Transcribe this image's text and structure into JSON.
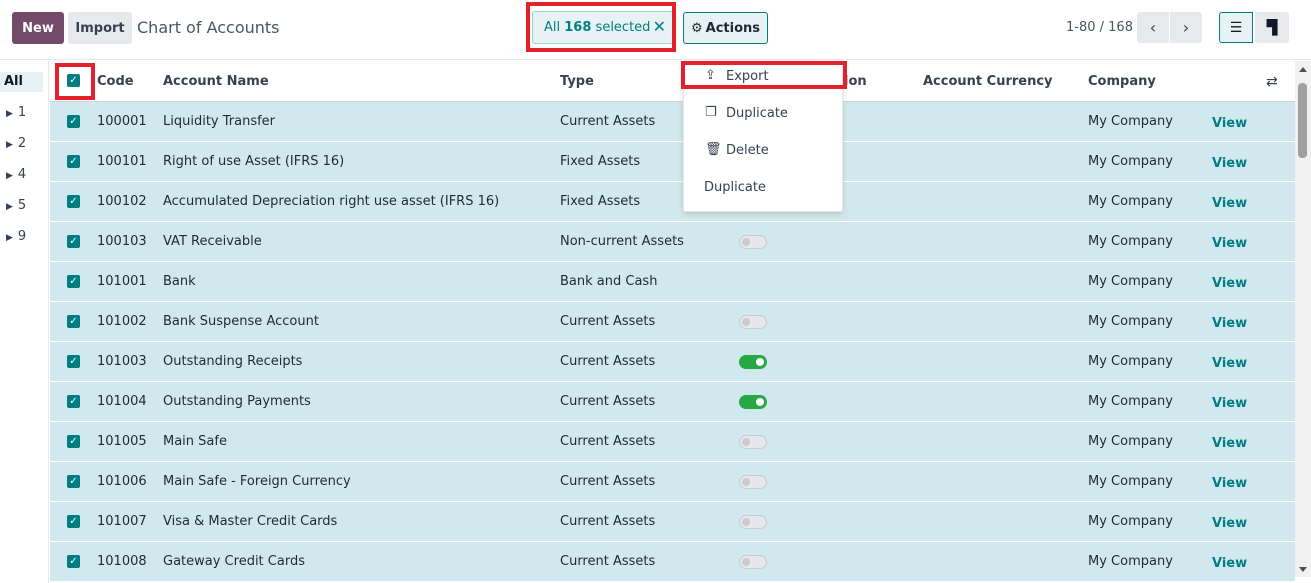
{
  "toolbar": {
    "new_label": "New",
    "import_label": "Import",
    "title": "Chart of Accounts",
    "selection_prefix": "All",
    "selection_count": "168",
    "selection_suffix": "selected",
    "clear_symbol": "✕",
    "actions_label": "Actions",
    "pager_text": "1-80 / 168",
    "prev_symbol": "‹",
    "next_symbol": "›"
  },
  "side_panel": {
    "all_label": "All",
    "groups": [
      "1",
      "2",
      "4",
      "5",
      "9"
    ]
  },
  "columns": {
    "code": "Code",
    "name": "Account Name",
    "type": "Type",
    "reconcile": "ion",
    "currency": "Account Currency",
    "company": "Company"
  },
  "actions_menu": {
    "export": "Export",
    "duplicate_icon_item": "Duplicate",
    "delete": "Delete",
    "duplicate": "Duplicate"
  },
  "rows": [
    {
      "code": "100001",
      "name": "Liquidity Transfer",
      "type": "Current Assets",
      "toggle": "none",
      "company": "My Company",
      "action": "View"
    },
    {
      "code": "100101",
      "name": "Right of use Asset (IFRS 16)",
      "type": "Fixed Assets",
      "toggle": "none",
      "company": "My Company",
      "action": "View"
    },
    {
      "code": "100102",
      "name": "Accumulated Depreciation right use asset (IFRS 16)",
      "type": "Fixed Assets",
      "toggle": "none",
      "company": "My Company",
      "action": "View"
    },
    {
      "code": "100103",
      "name": "VAT Receivable",
      "type": "Non-current Assets",
      "toggle": "off",
      "company": "My Company",
      "action": "View"
    },
    {
      "code": "101001",
      "name": "Bank",
      "type": "Bank and Cash",
      "toggle": "none",
      "company": "My Company",
      "action": "View"
    },
    {
      "code": "101002",
      "name": "Bank Suspense Account",
      "type": "Current Assets",
      "toggle": "off",
      "company": "My Company",
      "action": "View"
    },
    {
      "code": "101003",
      "name": "Outstanding Receipts",
      "type": "Current Assets",
      "toggle": "on",
      "company": "My Company",
      "action": "View"
    },
    {
      "code": "101004",
      "name": "Outstanding Payments",
      "type": "Current Assets",
      "toggle": "on",
      "company": "My Company",
      "action": "View"
    },
    {
      "code": "101005",
      "name": "Main Safe",
      "type": "Current Assets",
      "toggle": "off",
      "company": "My Company",
      "action": "View"
    },
    {
      "code": "101006",
      "name": "Main Safe - Foreign Currency",
      "type": "Current Assets",
      "toggle": "off",
      "company": "My Company",
      "action": "View"
    },
    {
      "code": "101007",
      "name": "Visa & Master Credit Cards",
      "type": "Current Assets",
      "toggle": "off",
      "company": "My Company",
      "action": "View"
    },
    {
      "code": "101008",
      "name": "Gateway Credit Cards",
      "type": "Current Assets",
      "toggle": "off",
      "company": "My Company",
      "action": "View"
    }
  ],
  "colors": {
    "brand": "#714B67",
    "accent": "#017e84",
    "row_selected": "#d1e9ee",
    "highlight_frame": "#e3212b",
    "toggle_on": "#28a745"
  },
  "icons": {
    "clear": "close-icon",
    "actions": "gear-icon",
    "list_view": "list-icon",
    "kanban_view": "kanban-icon",
    "export": "upload-icon",
    "duplicate": "copy-icon",
    "delete": "trash-icon",
    "columns": "sliders-icon"
  }
}
